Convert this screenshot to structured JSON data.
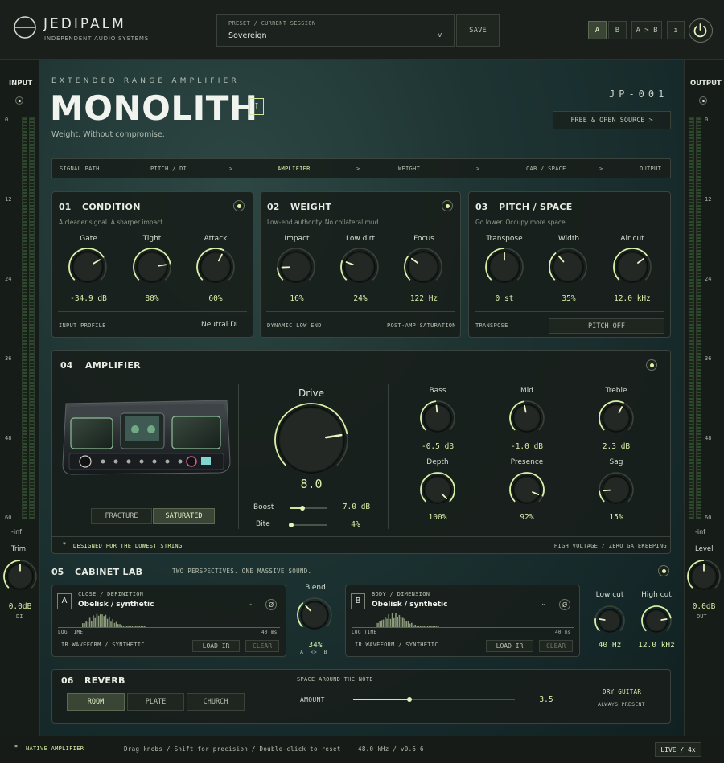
{
  "brand": {
    "name": "JEDIPALM",
    "tagline": "INDEPENDENT AUDIO SYSTEMS"
  },
  "preset": {
    "label": "PRESET / CURRENT SESSION",
    "value": "Sovereign",
    "save": "SAVE"
  },
  "topbuttons": {
    "a": "A",
    "b": "B",
    "ab": "A > B",
    "info": "i"
  },
  "hero": {
    "kicker": "EXTENDED RANGE AMPLIFIER",
    "title": "MONOLITH",
    "badge": "I",
    "subtitle": "Weight. Without compromise.",
    "model": "JP-001",
    "free": "FREE & OPEN SOURCE  >"
  },
  "path": {
    "items": [
      "SIGNAL PATH",
      "PITCH / DI",
      ">",
      "AMPLIFIER",
      ">",
      "WEIGHT",
      ">",
      "CAB / SPACE",
      ">",
      "OUTPUT"
    ]
  },
  "input": {
    "label": "INPUT",
    "ticks": [
      "0",
      "12",
      "24",
      "36",
      "48",
      "60"
    ],
    "inf": "-inf",
    "trim": "Trim",
    "trim_value": "0.0dB",
    "trim_sub": "DI"
  },
  "output": {
    "label": "OUTPUT",
    "ticks": [
      "0",
      "12",
      "24",
      "36",
      "48",
      "60"
    ],
    "inf": "-inf",
    "level": "Level",
    "level_value": "0.0dB",
    "level_sub": "OUT"
  },
  "condition": {
    "num": "01",
    "title": "CONDITION",
    "desc": "A cleaner signal. A sharper impact.",
    "knobs": [
      {
        "label": "Gate",
        "value": "-34.9 dB",
        "level": 0.72
      },
      {
        "label": "Tight",
        "value": "80%",
        "level": 0.8
      },
      {
        "label": "Attack",
        "value": "60%",
        "level": 0.6
      }
    ],
    "footer_left": "INPUT PROFILE",
    "footer_right": "Neutral DI"
  },
  "weight": {
    "num": "02",
    "title": "WEIGHT",
    "desc": "Low-end authority. No collateral mud.",
    "knobs": [
      {
        "label": "Impact",
        "value": "16%",
        "level": 0.16
      },
      {
        "label": "Low dirt",
        "value": "24%",
        "level": 0.24
      },
      {
        "label": "Focus",
        "value": "122 Hz",
        "level": 0.3
      }
    ],
    "footer_left": "DYNAMIC LOW END",
    "footer_right": "POST-AMP SATURATION"
  },
  "pitch": {
    "num": "03",
    "title": "PITCH / SPACE",
    "desc": "Go lower. Occupy more space.",
    "knobs": [
      {
        "label": "Transpose",
        "value": "0 st",
        "level": 0.5
      },
      {
        "label": "Width",
        "value": "35%",
        "level": 0.35
      },
      {
        "label": "Air cut",
        "value": "12.0 kHz",
        "level": 0.7
      }
    ],
    "footer_left": "TRANSPOSE",
    "footer_button": "PITCH OFF"
  },
  "amp": {
    "num": "04",
    "title": "AMPLIFIER",
    "modes": [
      "FRACTURE",
      "SATURATED"
    ],
    "drive_label": "Drive",
    "drive_value": "8.0",
    "drive_level": 0.8,
    "boost_label": "Boost",
    "boost_value": "7.0 dB",
    "boost_level": 0.35,
    "bite_label": "Bite",
    "bite_value": "4%",
    "bite_level": 0.04,
    "eq": [
      {
        "label": "Bass",
        "value": "-0.5 dB",
        "level": 0.48
      },
      {
        "label": "Mid",
        "value": "-1.0 dB",
        "level": 0.46
      },
      {
        "label": "Treble",
        "value": "2.3 dB",
        "level": 0.6
      },
      {
        "label": "Depth",
        "value": "100%",
        "level": 1.0
      },
      {
        "label": "Presence",
        "value": "92%",
        "level": 0.92
      },
      {
        "label": "Sag",
        "value": "15%",
        "level": 0.15
      }
    ],
    "footer_left": "DESIGNED FOR THE LOWEST STRING",
    "footer_right": "HIGH VOLTAGE / ZERO GATEKEEPING"
  },
  "cab": {
    "num": "05",
    "title": "CABINET LAB",
    "desc": "TWO PERSPECTIVES. ONE MASSIVE SOUND.",
    "a": {
      "letter": "A",
      "kicker": "CLOSE / DEFINITION",
      "name": "Obelisk / synthetic",
      "axis_left": "LOG TIME",
      "axis_right": "40 ms",
      "footer": "IR WAVEFORM / SYNTHETIC",
      "load": "LOAD IR",
      "clear": "CLEAR"
    },
    "b": {
      "letter": "B",
      "kicker": "BODY / DIMENSION",
      "name": "Obelisk / synthetic",
      "axis_left": "LOG TIME",
      "axis_right": "40 ms",
      "footer": "IR WAVEFORM / SYNTHETIC",
      "load": "LOAD IR",
      "clear": "CLEAR"
    },
    "blend_label": "Blend",
    "blend_value": "34%",
    "blend_level": 0.34,
    "blend_sub": "A  <>  B",
    "lowcut_label": "Low cut",
    "lowcut_value": "40 Hz",
    "lowcut_level": 0.2,
    "highcut_label": "High cut",
    "highcut_value": "12.0 kHz",
    "highcut_level": 0.8
  },
  "reverb": {
    "num": "06",
    "title": "REVERB",
    "types": [
      "ROOM",
      "PLATE",
      "CHURCH"
    ],
    "kicker": "SPACE AROUND THE NOTE",
    "amount_label": "AMOUNT",
    "amount_value": "3.5",
    "amount_level": 0.35,
    "side_title": "DRY GUITAR",
    "side_sub": "ALWAYS PRESENT"
  },
  "status": {
    "left": "NATIVE AMPLIFIER",
    "hint": "Drag knobs / Shift for precision / Double-click to reset",
    "rate": "48.0 kHz / v0.6.6",
    "live": "LIVE / 4x"
  },
  "colors": {
    "accent": "#d9f0a8",
    "panel": "#181e1a",
    "border": "#3b443c"
  }
}
